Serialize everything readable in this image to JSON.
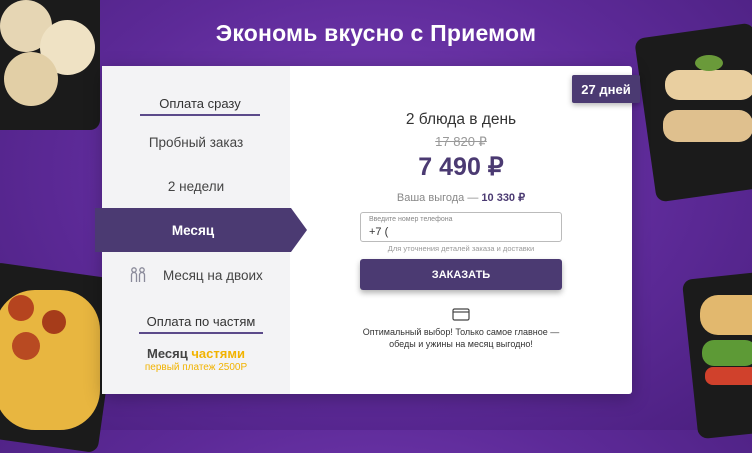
{
  "hero": {
    "title": "Экономь вкусно с Приемом"
  },
  "badge": {
    "days": "27 дней"
  },
  "sidebar": {
    "pay_now_title": "Оплата сразу",
    "items": {
      "trial": "Пробный заказ",
      "two_weeks": "2 недели",
      "month": "Месяц",
      "month_for_two": "Месяц на двоих"
    },
    "installments_title": "Оплата по частям",
    "installment_item": {
      "prefix": "Месяц",
      "accent": "частями",
      "sub": "первый платеж 2500Р"
    }
  },
  "offer": {
    "meals": "2 блюда в день",
    "old_price": "17 820 ₽",
    "price": "7 490 ₽",
    "savings_label": "Ваша выгода —",
    "savings_value": "10 330 ₽"
  },
  "form": {
    "phone_label": "Введите номер телефона",
    "phone_value": "+7 (",
    "hint": "Для уточнения деталей заказа и доставки",
    "order_button": "ЗАКАЗАТЬ"
  },
  "footer_note": {
    "line1": "Оптимальный выбор! Только самое главное —",
    "line2": "обеды и ужины на месяц выгодно!"
  },
  "colors": {
    "accent": "#4b3a72",
    "highlight": "#f2b300",
    "background": "#5d2a98"
  }
}
